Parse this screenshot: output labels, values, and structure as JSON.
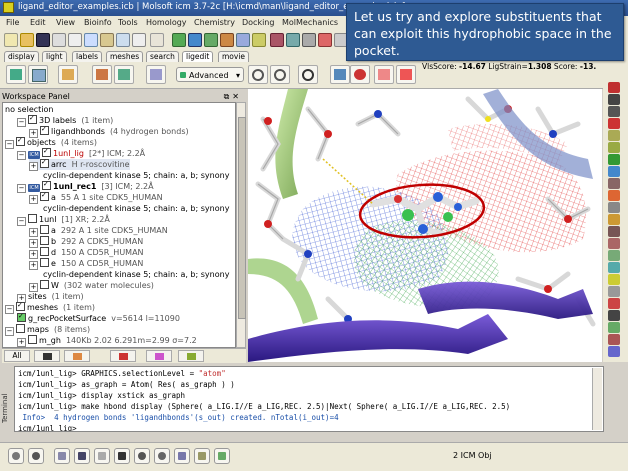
{
  "window": {
    "title": "ligand_editor_examples.icb | Molsoft icm 3.7-2c  [H:\\icmd\\man\\ligand_editor_examples.icb ]"
  },
  "menu": [
    "File",
    "Edit",
    "View",
    "Bioinfo",
    "Tools",
    "Homology",
    "Chemistry",
    "Docking",
    "MolMechanics",
    "Window",
    "Help"
  ],
  "tabs": [
    "display",
    "light",
    "labels",
    "meshes",
    "search",
    "ligedit",
    "movie"
  ],
  "active_tab": "ligedit",
  "toolbar2": {
    "advanced_label": "Advanced"
  },
  "scores": {
    "text": "VlsScore: ",
    "vls": "-14.67",
    "lig_label": " LigStrain=",
    "lig": "1.308",
    "score_label": " Score: ",
    "score": "-13."
  },
  "callout": "Let us try and explore substituents that can exploit this hydrophobic space in the pocket.",
  "workspace": {
    "title": "Workspace Panel",
    "rows": [
      {
        "text": "no selection"
      },
      {
        "text": "3D labels",
        "count": "(1 item)"
      },
      {
        "text": "ligandhbonds",
        "count": "(4 hydrogen bonds)"
      },
      {
        "text": "objects",
        "count": "(4 items)"
      },
      {
        "text": "1unl_lig",
        "count": "[2*] ICM; 2.2Å"
      },
      {
        "text": "arrc",
        "count": "H   r-roscovitine"
      },
      {
        "text": "cyclin-dependent kinase 5; chain: a, b; synony"
      },
      {
        "text": "1unl_rec1",
        "count": "[3] ICM; 2.2Å"
      },
      {
        "text": "a",
        "count": "55 A  1 site CDK5_HUMAN"
      },
      {
        "text": "cyclin-dependent kinase 5; chain: a, b; synony"
      },
      {
        "text": "1unl",
        "count": "[1] XR; 2.2Å"
      },
      {
        "text": "a",
        "count": "292 A  1 site CDK5_HUMAN"
      },
      {
        "text": "b",
        "count": "292 A  CDK5_HUMAN"
      },
      {
        "text": "d",
        "count": "150 A  CD5R_HUMAN"
      },
      {
        "text": "e",
        "count": "150 A  CD5R_HUMAN"
      },
      {
        "text": "cyclin-dependent kinase 5; chain: a, b; synony"
      },
      {
        "text": "W",
        "count": "(302 water molecules)"
      },
      {
        "text": "sites",
        "count": "(1 item)"
      },
      {
        "text": "meshes",
        "count": "(1 item)"
      },
      {
        "text": "g_recPocketSurface",
        "count": "v=5614 l=11090"
      },
      {
        "text": "maps",
        "count": "(8 items)"
      },
      {
        "text": "m_gh",
        "count": "140Kb 2.02 6.291m=2.99 σ=7.2"
      }
    ],
    "bottom_tab": "All"
  },
  "terminal": {
    "label": "Terminal",
    "lines": [
      {
        "prompt": "icm/1unl_lig> ",
        "code": "GRAPHICS.selectionLevel = ",
        "str": "\"atom\""
      },
      {
        "prompt": "icm/1unl_lig> ",
        "code": "as_graph = Atom( Res( as_graph ) )"
      },
      {
        "prompt": "icm/1unl_lig> ",
        "code": "display xstick as_graph"
      },
      {
        "prompt": "icm/1unl_lig> ",
        "code": "make hbond display (Sphere( a_LIG.I//E a_LIG,REC. 2.5)|Next( Sphere( a_LIG.I//E a_LIG,REC. 2.5)"
      },
      {
        "prompt": " Info> ",
        "code": " 4 hydrogen bonds 'ligandhbonds'(s_out) created. nTotal(i_out)=4",
        "info": true
      },
      {
        "prompt": "icm/1unl_lig> ",
        "code": ""
      }
    ]
  },
  "status": {
    "text": "2 ICM Obj"
  },
  "colors": {
    "callout": "#2e5a93",
    "titlebar": "#2a4f8e",
    "selection_ring": "#c00000"
  }
}
